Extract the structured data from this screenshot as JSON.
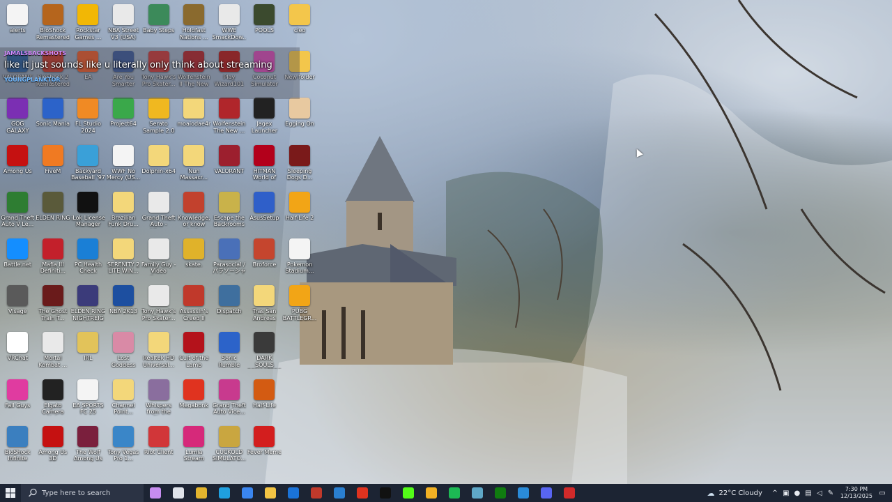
{
  "desktop": {
    "icons": [
      {
        "label": "alerts",
        "icon": "text-file-icon",
        "color": "#f4f4f4"
      },
      {
        "label": "BioShock Remastered",
        "icon": "bioshock-icon",
        "color": "#b5651d"
      },
      {
        "label": "Rockstar Games ...",
        "icon": "rockstar-icon",
        "color": "#f2b705"
      },
      {
        "label": "NBA Street V3 (USA)",
        "icon": "disc-icon",
        "color": "#e9e9e9"
      },
      {
        "label": "Baby Steps",
        "icon": "baby-steps-icon",
        "color": "#3c8a5a"
      },
      {
        "label": "Holdfast Nations ...",
        "icon": "holdfast-icon",
        "color": "#8a6a2e"
      },
      {
        "label": "WWE SmackDow...",
        "icon": "disc-icon",
        "color": "#e9e9e9"
      },
      {
        "label": "POOLS",
        "icon": "pools-icon",
        "color": "#3b4a2e"
      },
      {
        "label": "cleo",
        "icon": "folder-icon",
        "color": "#f3c64b"
      },
      {
        "label": "VALORANT",
        "icon": "valorant-icon",
        "color": "#2a5e9c"
      },
      {
        "label": "BioShock 2 Remastered",
        "icon": "bioshock2-icon",
        "color": "#c0392b"
      },
      {
        "label": "EA",
        "icon": "ea-icon",
        "color": "#e65a2a"
      },
      {
        "label": "Are You Smarter th...",
        "icon": "disc-icon",
        "color": "#3d5a99"
      },
      {
        "label": "Tony Hawk's Pro Skater...",
        "icon": "thps-icon",
        "color": "#c63a3a"
      },
      {
        "label": "Wolfenstein II The New C...",
        "icon": "wolfenstein-icon",
        "color": "#b0262b"
      },
      {
        "label": "Play Wizard101",
        "icon": "wizard101-icon",
        "color": "#b31c1c"
      },
      {
        "label": "Coconut Simulator",
        "icon": "coconut-icon",
        "color": "#d64ab5"
      },
      {
        "label": "New folder",
        "icon": "folder-icon",
        "color": "#f3c64b"
      },
      {
        "label": "GOG GALAXY",
        "icon": "gog-icon",
        "color": "#7b2fb3"
      },
      {
        "label": "Sonic Mania",
        "icon": "sonic-icon",
        "color": "#2c63c9"
      },
      {
        "label": "FL Studio 2024",
        "icon": "fl-studio-icon",
        "color": "#f08a24"
      },
      {
        "label": "Project64",
        "icon": "project64-icon",
        "color": "#3aa84a"
      },
      {
        "label": "Serato Sample 2.0",
        "icon": "serato-icon",
        "color": "#f0b820"
      },
      {
        "label": "moaiodae4r",
        "icon": "folder-icon",
        "color": "#f3d77a"
      },
      {
        "label": "Wolfenstein The New ...",
        "icon": "wolfenstein-icon",
        "color": "#b0262b"
      },
      {
        "label": "Jagex Launcher",
        "icon": "jagex-icon",
        "color": "#222222"
      },
      {
        "label": "Egging On",
        "icon": "egg-icon",
        "color": "#e8c9a0"
      },
      {
        "label": "Among Us",
        "icon": "among-us-icon",
        "color": "#c51111"
      },
      {
        "label": "FiveM",
        "icon": "fivem-icon",
        "color": "#f07a22"
      },
      {
        "label": "Backyard Baseball '97",
        "icon": "backyard-icon",
        "color": "#3aa0d8"
      },
      {
        "label": "WWF No Mercy (US...",
        "icon": "text-file-icon",
        "color": "#f4f4f4"
      },
      {
        "label": "Dolphin-x64",
        "icon": "folder-icon",
        "color": "#f3d77a"
      },
      {
        "label": "Nun Massacr...",
        "icon": "file-icon",
        "color": "#f3d77a"
      },
      {
        "label": "VALORANT",
        "icon": "valorant-icon",
        "color": "#9c1f2e"
      },
      {
        "label": "HITMAN World of As...",
        "icon": "hitman-icon",
        "color": "#b3001b"
      },
      {
        "label": "Sleeping Dogs D...",
        "icon": "sleeping-dogs-icon",
        "color": "#7a1a1a"
      },
      {
        "label": "Grand Theft Auto V Le...",
        "icon": "gta-icon",
        "color": "#2e7d32"
      },
      {
        "label": "ELDEN RING",
        "icon": "elden-ring-icon",
        "color": "#5a5a3a"
      },
      {
        "label": "iLok License Manager",
        "icon": "ilok-icon",
        "color": "#111111"
      },
      {
        "label": "Brazilian Funk Dru...",
        "icon": "folder-icon",
        "color": "#f3d77a"
      },
      {
        "label": "Grand Theft Auto - Libe...",
        "icon": "disc-icon",
        "color": "#e9e9e9"
      },
      {
        "label": "Knowledge, or know Lady",
        "icon": "knowledge-icon",
        "color": "#c2412d"
      },
      {
        "label": "Escape the Backrooms",
        "icon": "backrooms-icon",
        "color": "#c9b24a"
      },
      {
        "label": "AsusSetup",
        "icon": "asus-icon",
        "color": "#2f5fc9"
      },
      {
        "label": "Half-Life 2",
        "icon": "half-life-icon",
        "color": "#f2a516"
      },
      {
        "label": "Battle.net",
        "icon": "battlenet-icon",
        "color": "#148eff"
      },
      {
        "label": "Mafia III Definiti...",
        "icon": "mafia-icon",
        "color": "#c3202b"
      },
      {
        "label": "PC Health Check",
        "icon": "health-icon",
        "color": "#1a7fd6"
      },
      {
        "label": "SERENITY 2 LITE WIN...",
        "icon": "folder-icon",
        "color": "#f3d77a"
      },
      {
        "label": "Family Guy - Video Gam...",
        "icon": "disc-icon",
        "color": "#e9e9e9"
      },
      {
        "label": "skate.",
        "icon": "skate-icon",
        "color": "#e0b22a"
      },
      {
        "label": "Parasocial / パラソーシャル",
        "icon": "parasocial-icon",
        "color": "#4a70b8"
      },
      {
        "label": "Broforce",
        "icon": "broforce-icon",
        "color": "#c5452e"
      },
      {
        "label": "Pokemon Stadium...",
        "icon": "text-file-icon",
        "color": "#f4f4f4"
      },
      {
        "label": "Visage",
        "icon": "visage-icon",
        "color": "#5a5a5a"
      },
      {
        "label": "The Ghost Train T...",
        "icon": "ghost-train-icon",
        "color": "#6a1b1b"
      },
      {
        "label": "ELDEN RING NIGHTREIGN",
        "icon": "nightreign-icon",
        "color": "#3b3b7a"
      },
      {
        "label": "NBA 2K13",
        "icon": "nba2k-icon",
        "color": "#1d4fa0"
      },
      {
        "label": "Tony Hawk's Pro Skater...",
        "icon": "disc-icon",
        "color": "#e9e9e9"
      },
      {
        "label": "Assassin's Creed II",
        "icon": "assassins-icon",
        "color": "#c0392b"
      },
      {
        "label": "Dispatch",
        "icon": "dispatch-icon",
        "color": "#3f6f9e"
      },
      {
        "label": "Tras San Andreas",
        "icon": "folder-icon",
        "color": "#f3d77a"
      },
      {
        "label": "PUBG BATTLEGR...",
        "icon": "pubg-icon",
        "color": "#f2a516"
      },
      {
        "label": "VRChat",
        "icon": "vrchat-icon",
        "color": "#ffffff"
      },
      {
        "label": "Mortal Kombat ...",
        "icon": "disc-icon",
        "color": "#e9e9e9"
      },
      {
        "label": "IRL",
        "icon": "irl-icon",
        "color": "#e2c35a"
      },
      {
        "label": "Lost Goddess",
        "icon": "lost-goddess-icon",
        "color": "#d98aa6"
      },
      {
        "label": "Realtek HD Universal...",
        "icon": "folder-icon",
        "color": "#f3d77a"
      },
      {
        "label": "Cult of the Lamb",
        "icon": "cult-lamb-icon",
        "color": "#b4121b"
      },
      {
        "label": "Sonic Rumble",
        "icon": "sonic-icon",
        "color": "#2c63c9"
      },
      {
        "label": "DARK SOULS REMASTERED",
        "icon": "dark-souls-icon",
        "color": "#3a3a3a"
      },
      {
        "label": "",
        "icon": "blank-icon",
        "color": "transparent"
      },
      {
        "label": "Fall Guys",
        "icon": "fall-guys-icon",
        "color": "#e03ba0"
      },
      {
        "label": "Elgato Camera Hub",
        "icon": "elgato-icon",
        "color": "#222222"
      },
      {
        "label": "EA SPORTS FC 25",
        "icon": "text-file-icon",
        "color": "#f4f4f4"
      },
      {
        "label": "Channel Point...",
        "icon": "folder-icon",
        "color": "#f3d77a"
      },
      {
        "label": "Whispers from the Star",
        "icon": "whispers-icon",
        "color": "#8a6e9e"
      },
      {
        "label": "Megabonk",
        "icon": "megabonk-icon",
        "color": "#e0331f"
      },
      {
        "label": "Grand Theft Auto Vice...",
        "icon": "gta-vice-icon",
        "color": "#c83a8e"
      },
      {
        "label": "Half-Life",
        "icon": "half-life-icon",
        "color": "#d35b12"
      },
      {
        "label": "",
        "icon": "blank-icon",
        "color": "transparent"
      },
      {
        "label": "BioShock Infinite",
        "icon": "bioshock-infinite-icon",
        "color": "#3b7fbf"
      },
      {
        "label": "Among Us 3D",
        "icon": "among-us-icon",
        "color": "#c51111"
      },
      {
        "label": "The Wolf Among Us",
        "icon": "wolf-among-us-icon",
        "color": "#7a1f3d"
      },
      {
        "label": "Tony Vegas Pro 1...",
        "icon": "vegas-icon",
        "color": "#3a86c8"
      },
      {
        "label": "Riot Client",
        "icon": "riot-icon",
        "color": "#d13639"
      },
      {
        "label": "Lumia Stream",
        "icon": "lumia-icon",
        "color": "#d6297a"
      },
      {
        "label": "CUCKOLD SIMULATO...",
        "icon": "cuckold-sim-icon",
        "color": "#c9a640"
      },
      {
        "label": "Fever Meme",
        "icon": "fm-icon",
        "color": "#d31e1e"
      },
      {
        "label": "",
        "icon": "blank-icon",
        "color": "transparent"
      }
    ]
  },
  "chat": {
    "username": "JAMALSBACKSHOTS",
    "message": "like it just sounds like u literally only think about streaming",
    "username2": "YOUNGPLANKTOR"
  },
  "taskbar": {
    "search_placeholder": "Type here to search",
    "pinned": [
      {
        "name": "copilot-icon",
        "color": "#c78df0"
      },
      {
        "name": "task-view-icon",
        "color": "#dfe3ea"
      },
      {
        "name": "chrome-icon",
        "color": "#e3b52e"
      },
      {
        "name": "edge-icon",
        "color": "#1fa0e0"
      },
      {
        "name": "store-icon",
        "color": "#3a86f0"
      },
      {
        "name": "file-explorer-icon",
        "color": "#f2c444"
      },
      {
        "name": "outlook-icon",
        "color": "#1a73d8"
      },
      {
        "name": "app-icon",
        "color": "#c0392b"
      },
      {
        "name": "fall-guys-icon",
        "color": "#2a7fd0"
      },
      {
        "name": "megabonk-icon",
        "color": "#e0331f"
      },
      {
        "name": "tiktok-icon",
        "color": "#111111"
      },
      {
        "name": "kick-icon",
        "color": "#53fc18"
      },
      {
        "name": "steam-like-icon",
        "color": "#f2b124"
      },
      {
        "name": "spotify-icon",
        "color": "#1db954"
      },
      {
        "name": "notepad-icon",
        "color": "#5fa8c8"
      },
      {
        "name": "xbox-icon",
        "color": "#107c10"
      },
      {
        "name": "steam-icon",
        "color": "#2a8bd8"
      },
      {
        "name": "discord-icon",
        "color": "#5865f2"
      },
      {
        "name": "obs-icon",
        "color": "#d12a2a"
      }
    ],
    "weather": "22°C  Cloudy",
    "time": "7:30 PM",
    "date": "12/13/2025"
  }
}
